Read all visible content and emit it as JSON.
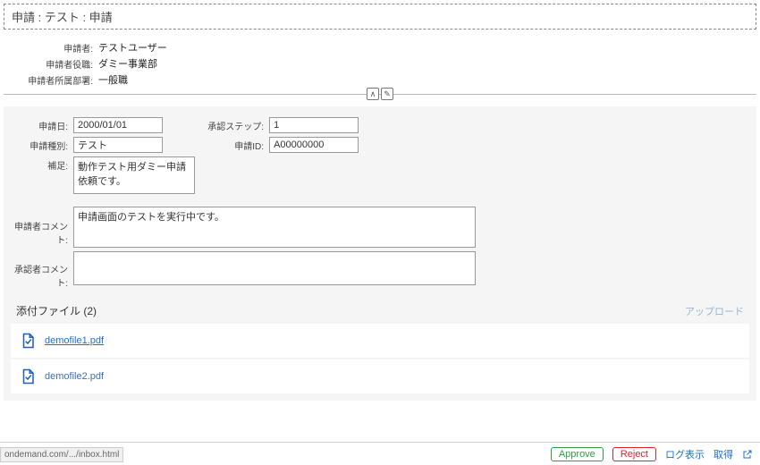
{
  "title": "申請 : テスト : 申請",
  "info": {
    "applicant_label": "申請者:",
    "applicant": "テストユーザー",
    "role_label": "申請者役職:",
    "role": "ダミー事業部",
    "dept_label": "申請者所属部署:",
    "dept": "一般職"
  },
  "divider_icons": {
    "collapse": "∧",
    "pin": "✎"
  },
  "form": {
    "date_label": "申請日:",
    "date_value": "2000/01/01",
    "type_label": "申請種別:",
    "type_value": "テスト",
    "note_label": "補足:",
    "note_value": "動作テスト用ダミー申請依頼です。",
    "step_label": "承認ステップ:",
    "step_value": "1",
    "id_label": "申請ID:",
    "id_value": "A00000000",
    "applicant_comment_label": "申請者コメント:",
    "applicant_comment_value": "申請画面のテストを実行中です。",
    "approver_comment_label": "承認者コメント:",
    "approver_comment_value": ""
  },
  "attach": {
    "title": "添付ファイル (2)",
    "upload": "アップロード",
    "files": [
      {
        "name": "demofile1.pdf",
        "linked": true
      },
      {
        "name": "demofile2.pdf",
        "linked": false
      }
    ]
  },
  "footer": {
    "url": "ondemand.com/.../inbox.html",
    "approve": "Approve",
    "reject": "Reject",
    "log": "ログ表示",
    "claim": "取得"
  }
}
